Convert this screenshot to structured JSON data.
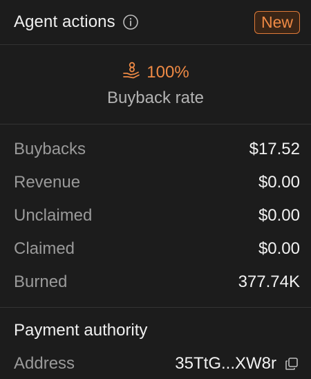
{
  "header": {
    "title": "Agent actions",
    "info_icon": "info-circle-icon",
    "badge": "New"
  },
  "buyback": {
    "icon": "hand-coins-icon",
    "rate": "100%",
    "label": "Buyback rate"
  },
  "stats": [
    {
      "label": "Buybacks",
      "value": "$17.52"
    },
    {
      "label": "Revenue",
      "value": "$0.00"
    },
    {
      "label": "Unclaimed",
      "value": "$0.00"
    },
    {
      "label": "Claimed",
      "value": "$0.00"
    },
    {
      "label": "Burned",
      "value": "377.74K"
    }
  ],
  "payment": {
    "title": "Payment authority",
    "address_label": "Address",
    "address_value": "35TtG...XW8r",
    "copy_icon": "copy-icon"
  },
  "colors": {
    "accent": "#ef8a45",
    "background": "#1c1c1c",
    "divider": "#333333"
  }
}
